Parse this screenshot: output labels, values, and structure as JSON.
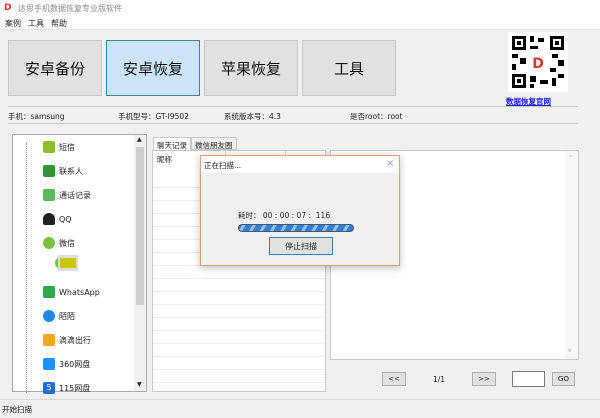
{
  "window": {
    "title": "达思手机数据恢复专业版软件"
  },
  "menu": [
    "案例",
    "工具",
    "帮助"
  ],
  "nav_buttons": [
    {
      "label": "安卓备份",
      "active": false
    },
    {
      "label": "安卓恢复",
      "active": true
    },
    {
      "label": "苹果恢复",
      "active": false
    },
    {
      "label": "工具",
      "active": false
    }
  ],
  "qr": {
    "link": "数据恢复官网"
  },
  "device_info": {
    "phone": "手机：samsung",
    "model": "手机型号：GT-I9502",
    "os_version": "系统版本号：4.3",
    "root": "是否root：root"
  },
  "tree": {
    "items": [
      "短信",
      "联系人",
      "通话记录",
      "QQ",
      "微信",
      "WhatsApp",
      "陌陌",
      "滴滴出行",
      "360网盘",
      "115网盘"
    ]
  },
  "tabs": [
    "聊天记录",
    "微信朋友圈"
  ],
  "table": {
    "columns": [
      "昵称",
      "",
      "",
      ""
    ]
  },
  "pager": {
    "prev": "<<",
    "page": "1/1",
    "next": ">>",
    "page_input": "",
    "go": "GO"
  },
  "dialog": {
    "title": "正在扫描...",
    "elapsed": "耗时： 00 : 00 : 07 :  116",
    "stop": "停止扫描",
    "progress": "indeterminate"
  },
  "status": "开始扫描",
  "colors": {
    "accent": "#3c7fb1",
    "active_btn": "#cce4f7",
    "progress": "#2f7fd8"
  }
}
